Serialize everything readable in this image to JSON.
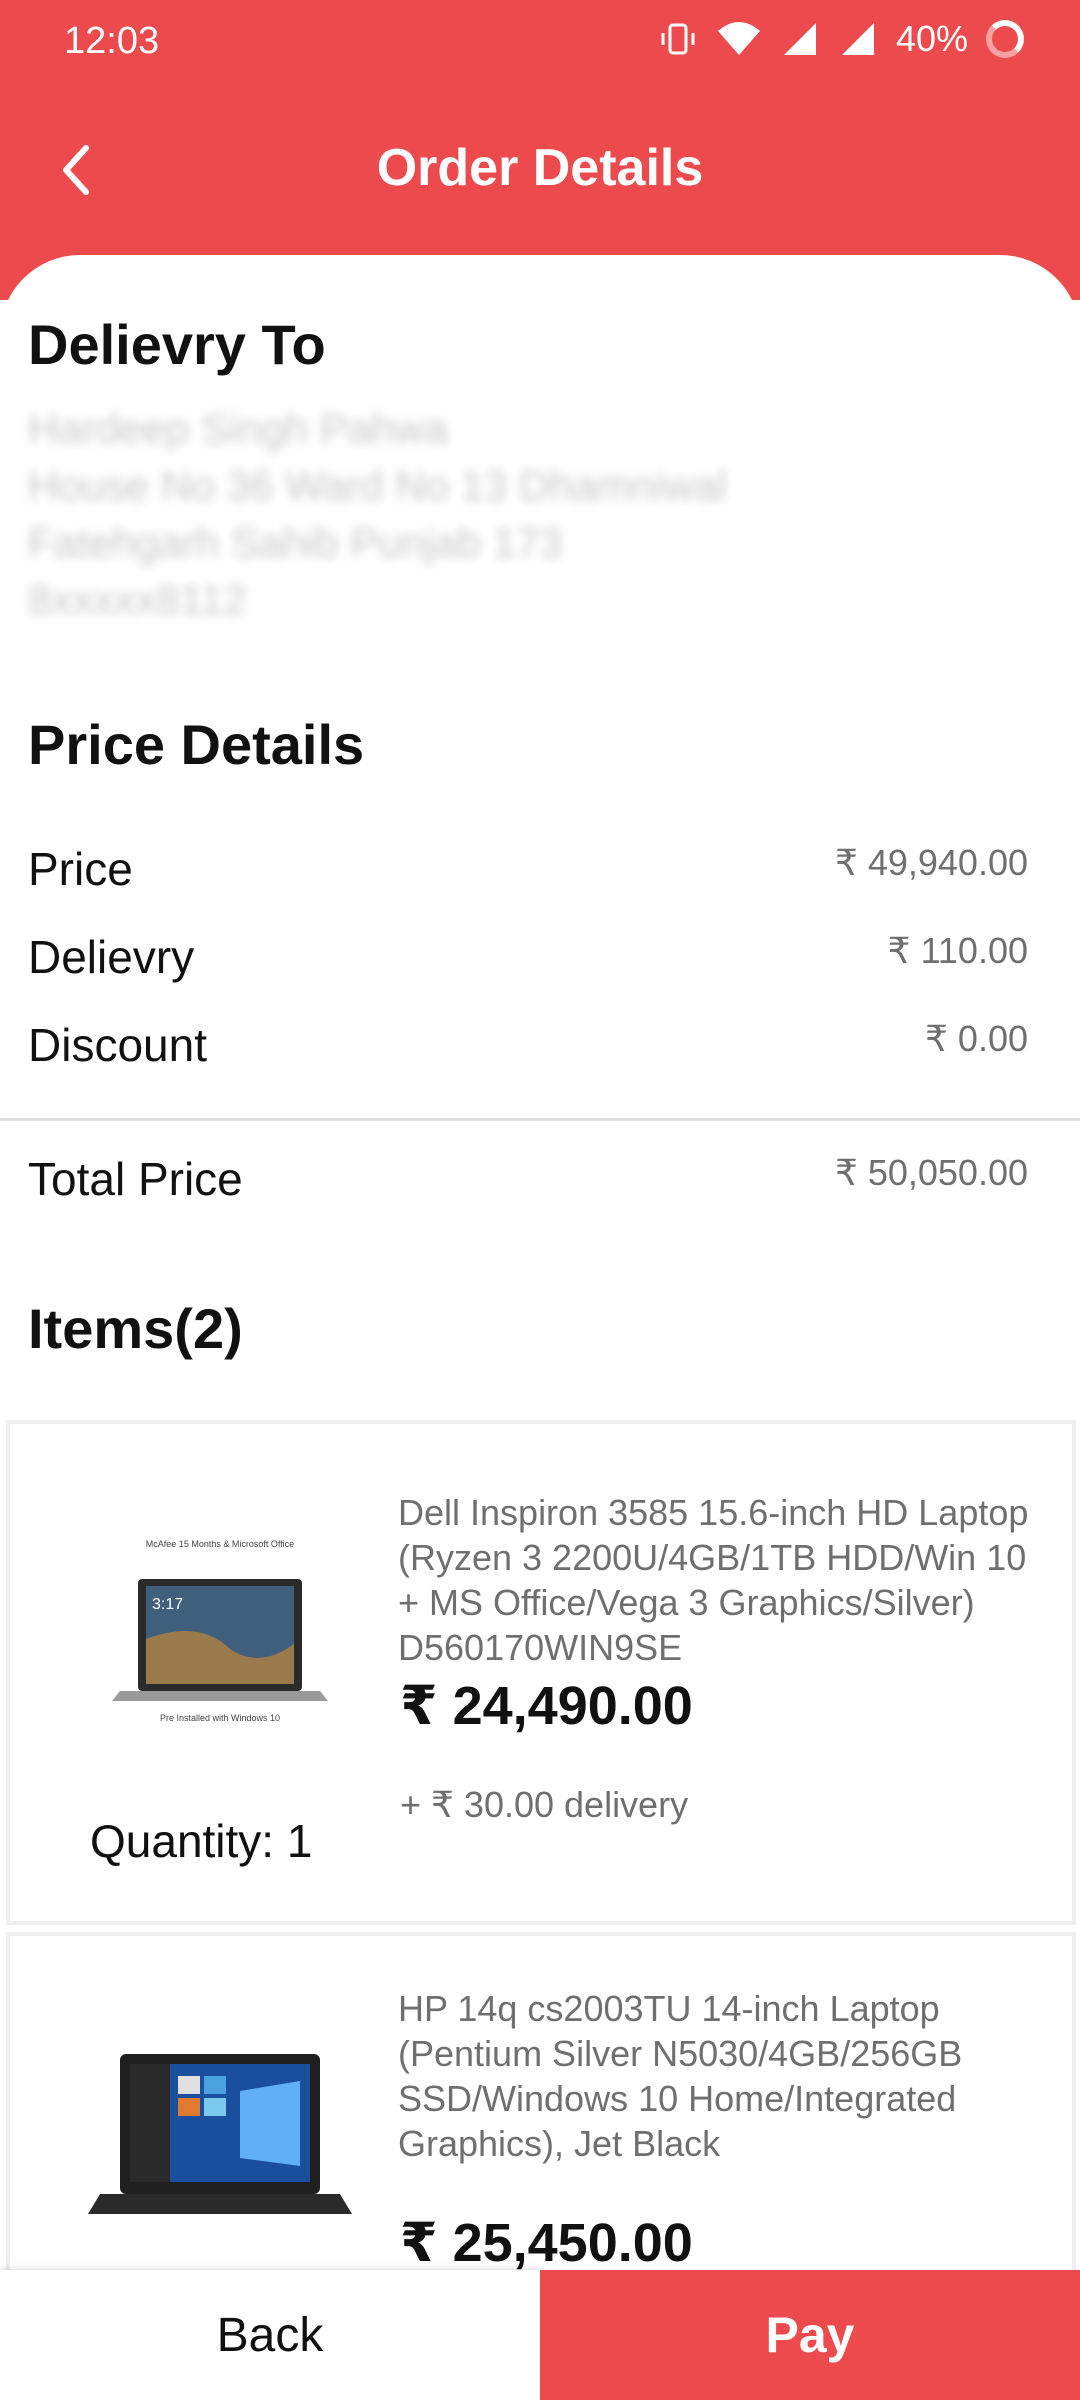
{
  "status_bar": {
    "time": "12:03",
    "battery": "40%"
  },
  "header": {
    "title": "Order Details",
    "accent": "#ed4a4d"
  },
  "delivery": {
    "heading": "Delievry To",
    "lines": [
      "Hardeep Singh Pahwa",
      "House No 36 Ward No 13 Dhamniwal",
      "Fatehgarh Sahib Punjab 173",
      "8xxxxx8112"
    ]
  },
  "price_details": {
    "heading": "Price Details",
    "rows": [
      {
        "label": "Price",
        "value": "₹ 49,940.00"
      },
      {
        "label": "Delievry",
        "value": "₹ 110.00"
      },
      {
        "label": "Discount",
        "value": "₹ 0.00"
      }
    ],
    "total": {
      "label": "Total Price",
      "value": "₹ 50,050.00"
    }
  },
  "items": {
    "heading": "Items(2)",
    "list": [
      {
        "name": "Dell Inspiron 3585 15.6-inch HD Laptop (Ryzen 3 2200U/4GB/1TB HDD/Win 10 + MS Office/Vega 3 Graphics/Silver) D560170WIN9SE",
        "price": "₹ 24,490.00",
        "delivery": "+ ₹ 30.00 delivery",
        "quantity": "Quantity: 1",
        "img_top_caption": "McAfee 15 Months & Microsoft Office",
        "img_bottom_caption": "Pre Installed with Windows 10",
        "img_time": "3:17"
      },
      {
        "name": "HP 14q cs2003TU 14-inch Laptop (Pentium Silver N5030/4GB/256GB SSD/Windows 10 Home/Integrated Graphics), Jet Black",
        "price": "₹ 25,450.00"
      }
    ]
  },
  "footer": {
    "back_label": "Back",
    "pay_label": "Pay"
  }
}
